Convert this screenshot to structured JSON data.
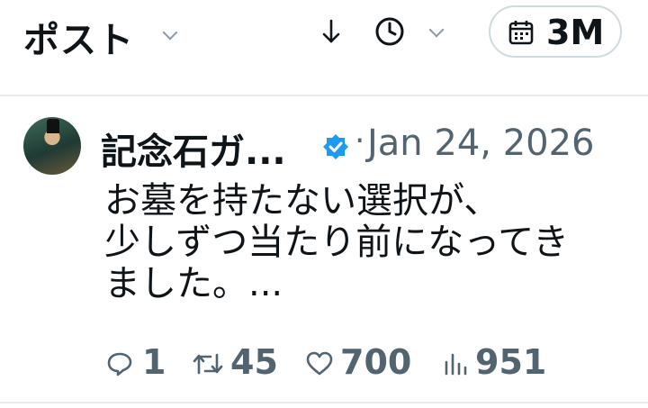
{
  "header": {
    "title": "ポスト",
    "range_label": "3M"
  },
  "post": {
    "author_name": "記念石ガ...",
    "separator": "·",
    "date": "Jan 24, 2026",
    "text_lines": [
      "お墓を持たない選択が、",
      "少しずつ当たり前になってき",
      "ました。..."
    ]
  },
  "stats": {
    "replies": "1",
    "reposts": "45",
    "likes": "700",
    "views": "951"
  },
  "colors": {
    "text": "#0f1419",
    "muted": "#536471",
    "verified": "#1d9bf0",
    "border": "#cfd9de"
  },
  "icons": [
    "chevron-down-icon",
    "arrow-down-icon",
    "clock-icon",
    "calendar-icon",
    "verified-badge-icon",
    "reply-icon",
    "repost-icon",
    "like-icon",
    "views-icon"
  ]
}
